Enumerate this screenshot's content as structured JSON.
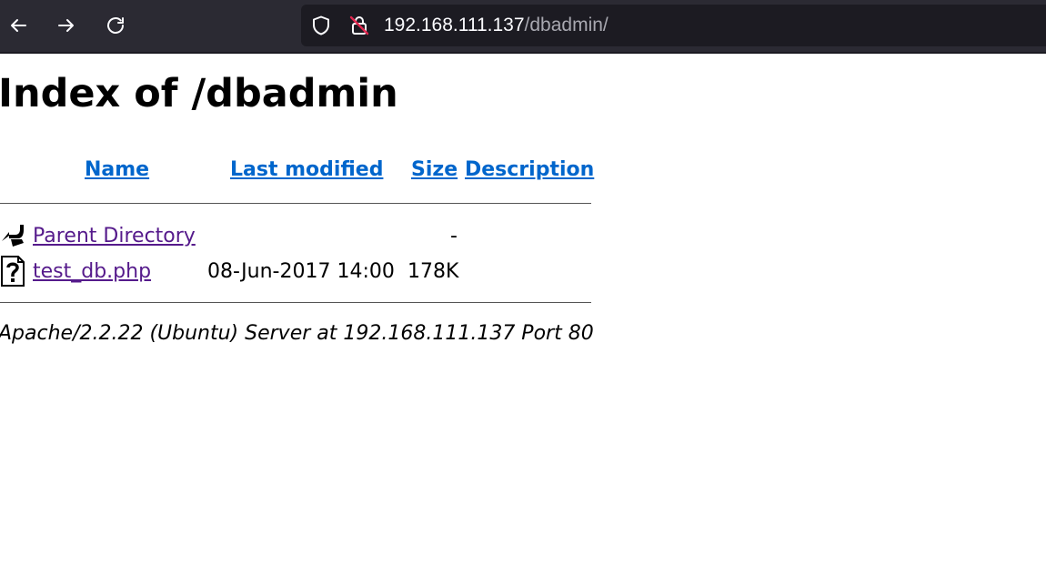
{
  "browser": {
    "url_host": "192.168.111.137",
    "url_path": "/dbadmin/",
    "icons": [
      "back-arrow-icon",
      "forward-arrow-icon",
      "reload-icon",
      "shield-icon",
      "insecure-lock-icon"
    ]
  },
  "page": {
    "title": "Index of /dbadmin",
    "columns": {
      "name": "Name",
      "last_modified": "Last modified",
      "size": "Size",
      "description": "Description"
    },
    "rows": [
      {
        "icon": "back-folder-icon",
        "name": "Parent Directory",
        "last_modified": "",
        "size": "-",
        "description": ""
      },
      {
        "icon": "unknown-file-icon",
        "name": "test_db.php",
        "last_modified": "08-Jun-2017 14:00",
        "size": "178K",
        "description": ""
      }
    ],
    "footer": "Apache/2.2.22 (Ubuntu) Server at 192.168.111.137 Port 80"
  },
  "colors": {
    "toolbar_bg": "#2b2a33",
    "urlbar_bg": "#1c1b22",
    "link": "#0066cc",
    "visited_link": "#551a8b"
  }
}
